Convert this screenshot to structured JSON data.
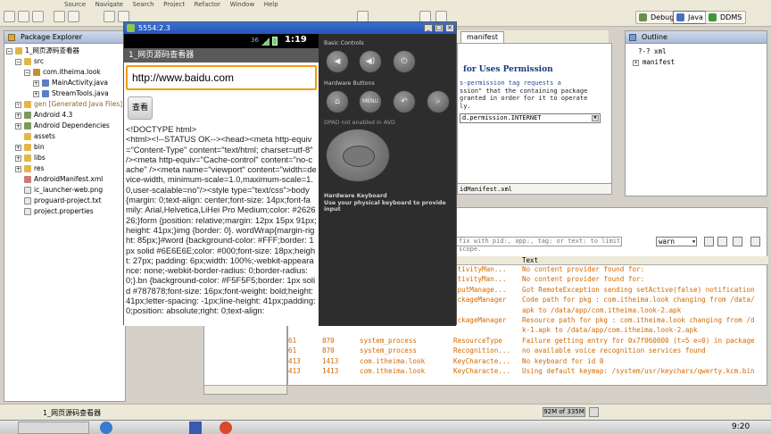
{
  "menu": [
    "Source",
    "Navigate",
    "Search",
    "Project",
    "Refactor",
    "Window",
    "Help"
  ],
  "perspectives": {
    "debug": "Debug",
    "java": "Java",
    "ddms": "DDMS"
  },
  "package_explorer": {
    "title": "Package Explorer",
    "items": [
      "1_网页源码查看器",
      "src",
      "com.itheima.look",
      "MainActivity.java",
      "StreamTools.java",
      "gen [Generated Java Files]",
      "Android 4.3",
      "Android Dependencies",
      "assets",
      "bin",
      "libs",
      "res",
      "AndroidManifest.xml",
      "ic_launcher-web.png",
      "proguard-project.txt",
      "project.properties"
    ]
  },
  "emulator": {
    "window_title": "5554:2.3",
    "status_time": "1:19",
    "status_signal": "36",
    "app_title": "1_网页源码查看器",
    "url": "http://www.baidu.com",
    "view_button": "查看",
    "source_text": "<!DOCTYPE html>\n<html><!--STATUS OK--><head><meta http-equiv=\"Content-Type\" content=\"text/html; charset=utf-8\" /><meta http-equiv=\"Cache-control\" content=\"no-cache\" /><meta name=\"viewport\" content=\"width=device-width, minimum-scale=1.0,maximum-scale=1.0,user-scalable=no\"/><style type=\"text/css\">body {margin: 0;text-align: center;font-size: 14px;font-family: Arial,Helvetica,LiHei Pro Medium;color: #262626;}form {position: relative;margin: 12px 15px 91px;height: 41px;}img {border: 0}. wordWrap{margin-right: 85px;}#word {background-color: #FFF;border: 1px solid #6E6E6E;color: #000;font-size: 18px;height: 27px; padding: 6px;width: 100%;-webkit-appearance: none;-webkit-border-radius: 0;border-radius: 0;}.bn {background-color: #F5F5F5;border: 1px solid #787878;font-size: 16px;font-weight: bold;height: 41px;letter-spacing: -1px;line-height: 41px;padding: 0;position: absolute;right: 0;text-align:",
    "basic_controls": "Basic Controls",
    "hardware_buttons": "Hardware Buttons",
    "menu_label": "MENU",
    "dpad_note": "DPAD not enabled in AVD",
    "keyboard_title": "Hardware Keyboard",
    "keyboard_note": "Use your physical keyboard to provide input"
  },
  "editor": {
    "tab": "manifest",
    "heading": "for Uses Permission",
    "lines": [
      "s-permission tag requests a",
      "ssion\" that the containing package",
      "granted in order for it to operate",
      "ly."
    ],
    "select_value": "d.permission.INTERNET",
    "bottom_tab": "idManifest.xml"
  },
  "outline": {
    "title": "Outline",
    "items": [
      "?-? xml",
      "manifest"
    ]
  },
  "logcat": {
    "filter_placeholder": "fix with pid:, app:, tag: or text: to limit scope.",
    "level": "warn",
    "text_header": "Text",
    "rows": [
      {
        "pid": "",
        "tid": "",
        "app": "",
        "tag": "ctivityMan...",
        "text": "No content provider found for:"
      },
      {
        "pid": "",
        "tid": "",
        "app": "",
        "tag": "ctivityMan...",
        "text": "No content provider found for:"
      },
      {
        "pid": "",
        "tid": "",
        "app": "",
        "tag": "nputManage...",
        "text": "Got RemoteException sending setActive(false) notification"
      },
      {
        "pid": "",
        "tid": "",
        "app": "",
        "tag": "ackageManager",
        "text": "Code path for pkg : com.itheima.look changing from /data/"
      },
      {
        "pid": "",
        "tid": "",
        "app": "",
        "tag": "",
        "text": "apk to /data/app/com.itheima.look-2.apk"
      },
      {
        "pid": "",
        "tid": "",
        "app": "",
        "tag": "ackageManager",
        "text": "Resource path for pkg : com.itheima.look changing from /d"
      },
      {
        "pid": "",
        "tid": "",
        "app": "",
        "tag": "",
        "text": "k-1.apk to /data/app/com.itheima.look-2.apk"
      },
      {
        "pid": "61",
        "tid": "870",
        "app": "system_process",
        "tag": "ResourceType",
        "text": "Failure getting entry for 0x7f060000 (t=5 e=0) in package"
      },
      {
        "pid": "61",
        "tid": "870",
        "app": "system_process",
        "tag": "Recognition...",
        "text": "no available voice recognition services found"
      },
      {
        "pid": "413",
        "tid": "1413",
        "app": "com.itheima.look",
        "tag": "KeyCharacte...",
        "text": "No keyboard for id 0"
      },
      {
        "pid": "413",
        "tid": "1413",
        "app": "com.itheima.look",
        "tag": "KeyCharacte...",
        "text": "Using default keymap: /system/usr/keychars/qwerty.kcm.bin"
      }
    ]
  },
  "status": {
    "project": "1_网页源码查看器",
    "memory": "92M of 335M"
  },
  "taskbar": {
    "time": "9:20"
  }
}
